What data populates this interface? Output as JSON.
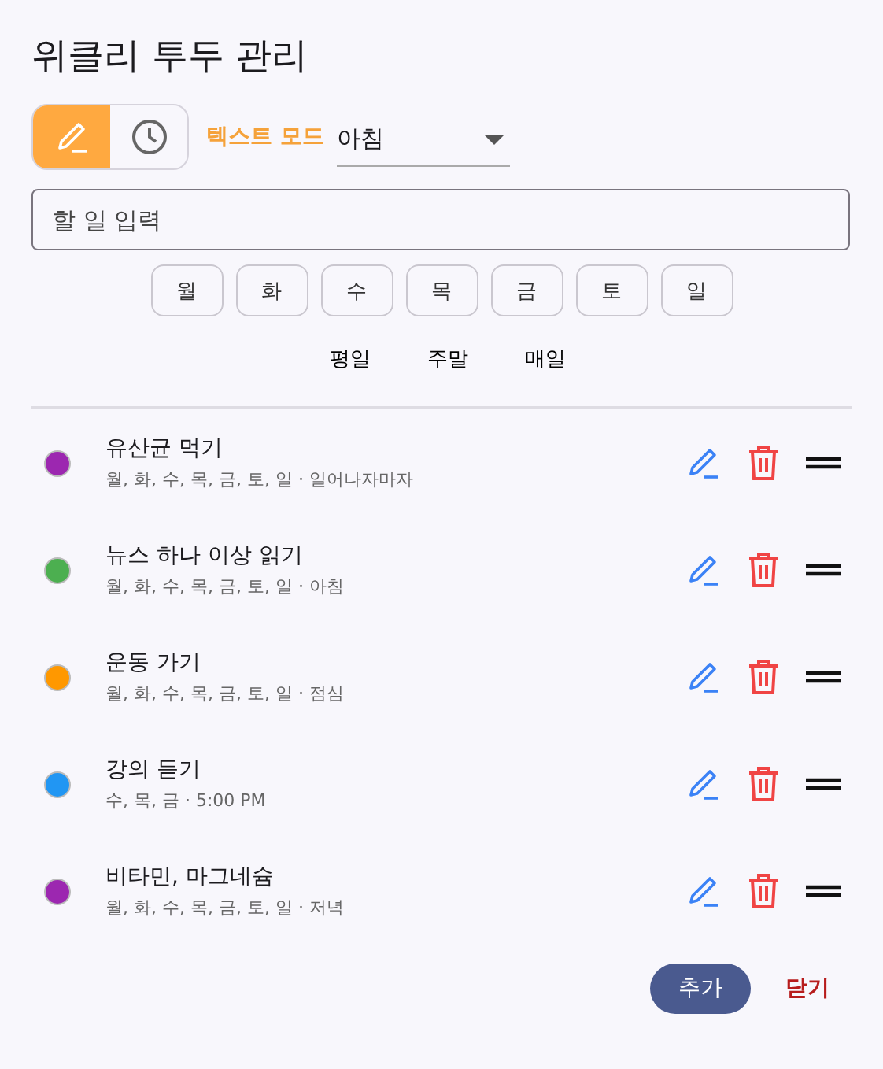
{
  "dialog": {
    "title": "위클리 투두 관리"
  },
  "modes": [
    {
      "kind": "text",
      "selected": true
    },
    {
      "kind": "time",
      "selected": false
    }
  ],
  "mode_label": "텍스트 모드",
  "time_select": {
    "value": "아침"
  },
  "task_input": {
    "placeholder": "할 일 입력"
  },
  "days": [
    {
      "label": "월",
      "selected": false
    },
    {
      "label": "화",
      "selected": false
    },
    {
      "label": "수",
      "selected": false
    },
    {
      "label": "목",
      "selected": false
    },
    {
      "label": "금",
      "selected": false
    },
    {
      "label": "토",
      "selected": false
    },
    {
      "label": "일",
      "selected": false
    }
  ],
  "presets": [
    "평일",
    "주말",
    "매일"
  ],
  "todos": [
    {
      "title": "유산균 먹기",
      "detail": "월, 화, 수, 목, 금, 토, 일 · 일어나자마자",
      "color": "#9c27b0"
    },
    {
      "title": "뉴스 하나 이상 읽기",
      "detail": "월, 화, 수, 목, 금, 토, 일 · 아침",
      "color": "#4caf50"
    },
    {
      "title": "운동 가기",
      "detail": "월, 화, 수, 목, 금, 토, 일 · 점심",
      "color": "#ff9800"
    },
    {
      "title": "강의 듣기",
      "detail": "수, 목, 금 · 5:00 PM",
      "color": "#2196f3"
    },
    {
      "title": "비타민, 마그네슘",
      "detail": "월, 화, 수, 목, 금, 토, 일 · 저녁",
      "color": "#9c27b0"
    }
  ],
  "buttons": {
    "add": "추가",
    "close": "닫기"
  }
}
